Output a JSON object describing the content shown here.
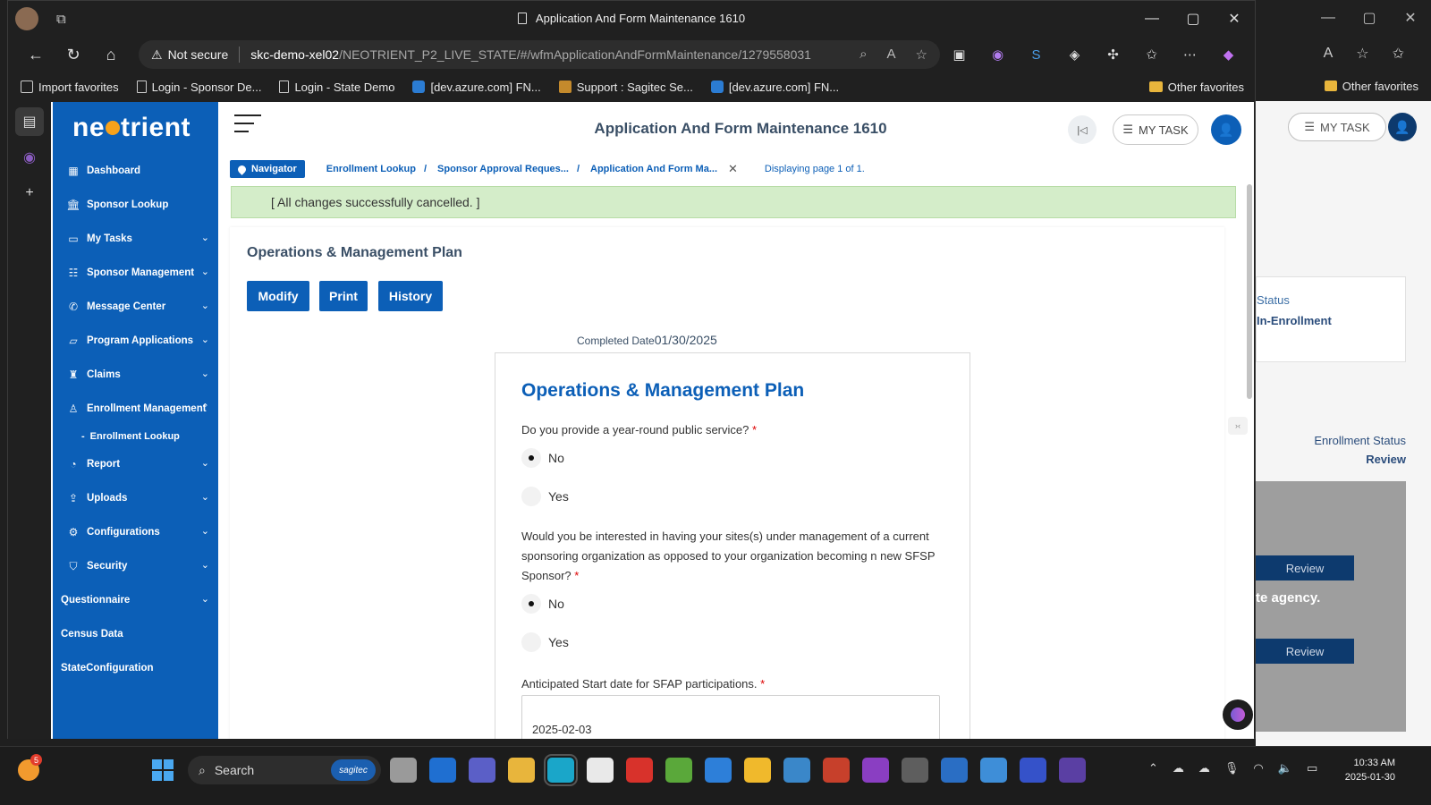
{
  "browser": {
    "window_title": "Application And Form Maintenance 1610",
    "security_label": "Not secure",
    "url_host": "skc-demo-xel02",
    "url_path": "/NEOTRIENT_P2_LIVE_STATE/#/wfmApplicationAndFormMaintenance/1279558031",
    "favorites": [
      {
        "label": "Import favorites",
        "icon": "import-icon"
      },
      {
        "label": "Login - Sponsor De...",
        "icon": "page-icon"
      },
      {
        "label": "Login - State Demo",
        "icon": "page-icon"
      },
      {
        "label": "[dev.azure.com] FN...",
        "icon": "azure-icon"
      },
      {
        "label": "Support : Sagitec Se...",
        "icon": "sagitec-icon"
      },
      {
        "label": "[dev.azure.com] FN...",
        "icon": "azure-icon"
      }
    ],
    "other_favorites": "Other favorites"
  },
  "app": {
    "logo_left": "ne",
    "logo_right": "trient",
    "header_title": "Application And Form Maintenance 1610",
    "my_task_label": "MY TASK"
  },
  "sidebar": {
    "items": [
      {
        "label": "Dashboard",
        "icon": "grid-icon",
        "chev": ""
      },
      {
        "label": "Sponsor Lookup",
        "icon": "bank-icon",
        "chev": ""
      },
      {
        "label": "My Tasks",
        "icon": "tasks-icon",
        "chev": "⌄"
      },
      {
        "label": "Sponsor Management",
        "icon": "management-icon",
        "chev": "⌄"
      },
      {
        "label": "Message Center",
        "icon": "phone-icon",
        "chev": "⌄"
      },
      {
        "label": "Program Applications",
        "icon": "folder-icon",
        "chev": "⌄"
      },
      {
        "label": "Claims",
        "icon": "claims-icon",
        "chev": "⌄"
      },
      {
        "label": "Enrollment Management",
        "icon": "user-edit-icon",
        "chev": "⌃"
      },
      {
        "label": "Report",
        "icon": "pie-icon",
        "chev": "⌄"
      },
      {
        "label": "Uploads",
        "icon": "upload-icon",
        "chev": "⌄"
      },
      {
        "label": "Configurations",
        "icon": "gear-icon",
        "chev": "⌄"
      },
      {
        "label": "Security",
        "icon": "shield-icon",
        "chev": "⌄"
      },
      {
        "label": "Questionnaire",
        "icon": "",
        "chev": "⌄"
      },
      {
        "label": "Census Data",
        "icon": "",
        "chev": ""
      },
      {
        "label": "StateConfiguration",
        "icon": "",
        "chev": ""
      }
    ],
    "sub_item": "Enrollment Lookup"
  },
  "breadcrumb": {
    "navigator": "Navigator",
    "items": [
      "Enrollment Lookup",
      "Sponsor Approval Reques...",
      "Application And Form Ma..."
    ],
    "separator": "/",
    "page_info": "Displaying page 1 of 1."
  },
  "banner": "[ All changes successfully cancelled. ]",
  "content": {
    "title": "Operations & Management Plan",
    "buttons": {
      "modify": "Modify",
      "print": "Print",
      "history": "History"
    },
    "completed_label": "Completed Date",
    "completed_value": "01/30/2025"
  },
  "form": {
    "title": "Operations & Management Plan",
    "q1": "Do you provide a year-round public service?",
    "q1_options": [
      {
        "label": "No",
        "selected": true
      },
      {
        "label": "Yes",
        "selected": false
      }
    ],
    "q2": "Would you be interested in having your sites(s) under management of a current sponsoring organization as opposed to your organization becoming n new SFSP Sponsor?",
    "q2_options": [
      {
        "label": "No",
        "selected": true
      },
      {
        "label": "Yes",
        "selected": false
      }
    ],
    "q3": "Anticipated Start date for SFAP participations.",
    "q3_value": "2025-02-03",
    "required_mark": "*"
  },
  "background_window": {
    "status_label": "Status",
    "status_value": "In-Enrollment",
    "enrollment_status_label": "Enrollment Status",
    "enrollment_status_value": "Review",
    "review_button": "Review",
    "agency_text": "te agency."
  },
  "taskbar": {
    "search_placeholder": "Search",
    "search_brand": "sagitec",
    "weather_badge": "5",
    "time": "10:33 AM",
    "date": "2025-01-30"
  },
  "colors": {
    "sidebar": "#0c5fb7",
    "accent_orange": "#f7a21b",
    "banner_bg": "#d4edc9"
  }
}
